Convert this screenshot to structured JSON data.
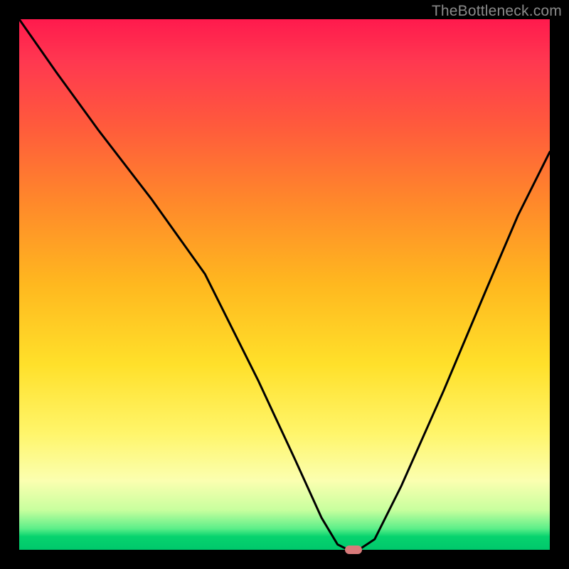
{
  "watermark": {
    "text": "TheBottleneck.com"
  },
  "chart_data": {
    "type": "line",
    "title": "",
    "xlabel": "",
    "ylabel": "",
    "xlim": [
      0,
      100
    ],
    "ylim": [
      0,
      100
    ],
    "background_gradient": {
      "direction": "vertical",
      "stops": [
        {
          "pos": 0,
          "color": "#ff1a4d"
        },
        {
          "pos": 0.35,
          "color": "#ff8a2a"
        },
        {
          "pos": 0.65,
          "color": "#ffe02a"
        },
        {
          "pos": 0.9,
          "color": "#fbffb0"
        },
        {
          "pos": 0.97,
          "color": "#07d36e"
        },
        {
          "pos": 1.0,
          "color": "#00c86c"
        }
      ]
    },
    "series": [
      {
        "name": "bottleneck-curve",
        "color": "#000000",
        "x": [
          0,
          7,
          15,
          25,
          35,
          45,
          52,
          57,
          60,
          62,
          64,
          67,
          72,
          80,
          88,
          94,
          100
        ],
        "y": [
          100,
          90,
          79,
          66,
          52,
          32,
          17,
          6,
          1,
          0,
          0,
          2,
          12,
          30,
          49,
          63,
          75
        ]
      }
    ],
    "marker": {
      "x": 63,
      "y": 0,
      "color": "#d97a7a"
    },
    "annotations": []
  }
}
